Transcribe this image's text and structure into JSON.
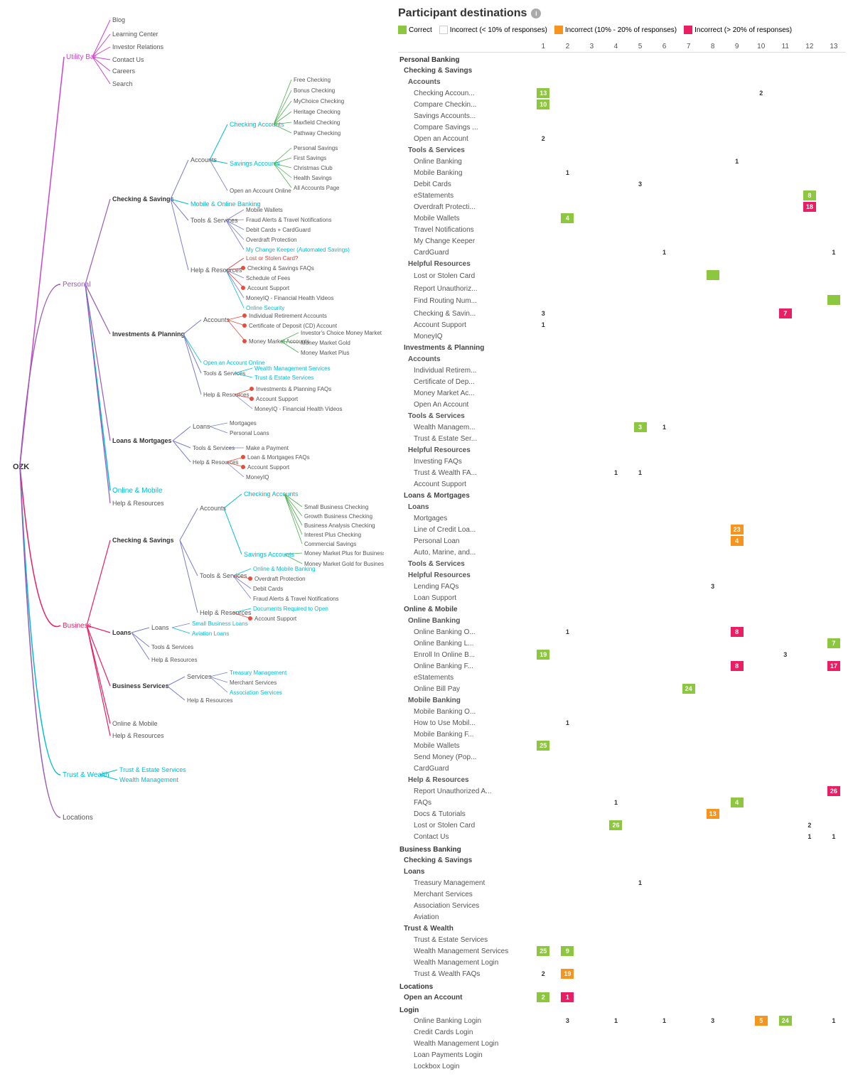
{
  "title": "Participant destinations",
  "legend": [
    {
      "label": "Correct",
      "type": "correct"
    },
    {
      "label": "Incorrect (< 10% of responses)",
      "type": "incorrect-10"
    },
    {
      "label": "Incorrect (10% - 20% of responses)",
      "type": "incorrect-20"
    },
    {
      "label": "Incorrect (> 20% of responses)",
      "type": "incorrect-more"
    }
  ],
  "columns": [
    "1",
    "2",
    "3",
    "4",
    "5",
    "6",
    "7",
    "8",
    "9",
    "10",
    "11",
    "12",
    "13"
  ],
  "rows": [
    {
      "label": "Personal Banking",
      "type": "section-header",
      "cells": []
    },
    {
      "label": "Checking & Savings",
      "type": "sub-header",
      "cells": []
    },
    {
      "label": "Accounts",
      "type": "sub-header2",
      "cells": []
    },
    {
      "label": "Checking Accoun...",
      "type": "item",
      "cells": [
        {
          "col": 1,
          "val": "13",
          "color": "green"
        },
        {
          "col": 10,
          "val": "2",
          "color": "white"
        }
      ]
    },
    {
      "label": "Compare Checkin...",
      "type": "item",
      "cells": [
        {
          "col": 1,
          "val": "10",
          "color": "green"
        }
      ]
    },
    {
      "label": "Savings Accounts...",
      "type": "item",
      "cells": []
    },
    {
      "label": "Compare Savings ...",
      "type": "item",
      "cells": []
    },
    {
      "label": "Open an Account",
      "type": "item",
      "cells": [
        {
          "col": 1,
          "val": "2",
          "color": "white"
        }
      ]
    },
    {
      "label": "Tools & Services",
      "type": "sub-header2",
      "cells": []
    },
    {
      "label": "Online Banking",
      "type": "item",
      "cells": [
        {
          "col": 9,
          "val": "1",
          "color": "white"
        }
      ]
    },
    {
      "label": "Mobile Banking",
      "type": "item",
      "cells": [
        {
          "col": 2,
          "val": "1",
          "color": "white"
        }
      ]
    },
    {
      "label": "Debit Cards",
      "type": "item",
      "cells": [
        {
          "col": 5,
          "val": "3",
          "color": "white"
        }
      ]
    },
    {
      "label": "eStatements",
      "type": "item",
      "cells": [
        {
          "col": 12,
          "val": "8",
          "color": "green"
        }
      ]
    },
    {
      "label": "Overdraft Protecti...",
      "type": "item",
      "cells": [
        {
          "col": 12,
          "val": "18",
          "color": "pink"
        }
      ]
    },
    {
      "label": "Mobile Wallets",
      "type": "item",
      "cells": [
        {
          "col": 2,
          "val": "4",
          "color": "green"
        }
      ]
    },
    {
      "label": "Travel Notifications",
      "type": "item",
      "cells": []
    },
    {
      "label": "My Change Keeper",
      "type": "item",
      "cells": []
    },
    {
      "label": "CardGuard",
      "type": "item",
      "cells": [
        {
          "col": 6,
          "val": "1",
          "color": "white"
        },
        {
          "col": 13,
          "val": "1",
          "color": "white"
        }
      ]
    },
    {
      "label": "Helpful Resources",
      "type": "sub-header2",
      "cells": []
    },
    {
      "label": "Lost or Stolen Card",
      "type": "item",
      "cells": [
        {
          "col": 8,
          "val": "",
          "color": "green"
        }
      ]
    },
    {
      "label": "Report Unauthoriz...",
      "type": "item",
      "cells": []
    },
    {
      "label": "Find Routing Num...",
      "type": "item",
      "cells": [
        {
          "col": 13,
          "val": "",
          "color": "green"
        }
      ]
    },
    {
      "label": "Checking & Savin...",
      "type": "item",
      "cells": [
        {
          "col": 1,
          "val": "3",
          "color": "white"
        },
        {
          "col": 11,
          "val": "7",
          "color": "pink"
        }
      ]
    },
    {
      "label": "Account Support",
      "type": "item",
      "cells": [
        {
          "col": 1,
          "val": "1",
          "color": "white"
        }
      ]
    },
    {
      "label": "MoneyIQ",
      "type": "item",
      "cells": []
    },
    {
      "label": "Investments & Planning",
      "type": "sub-header",
      "cells": []
    },
    {
      "label": "Accounts",
      "type": "sub-header2",
      "cells": []
    },
    {
      "label": "Individual Retirem...",
      "type": "item",
      "cells": []
    },
    {
      "label": "Certificate of Dep...",
      "type": "item",
      "cells": []
    },
    {
      "label": "Money Market Ac...",
      "type": "item",
      "cells": []
    },
    {
      "label": "Open An Account",
      "type": "item",
      "cells": []
    },
    {
      "label": "Tools & Services",
      "type": "sub-header2",
      "cells": []
    },
    {
      "label": "Wealth Managem...",
      "type": "item",
      "cells": [
        {
          "col": 5,
          "val": "3",
          "color": "green"
        },
        {
          "col": 6,
          "val": "1",
          "color": "white"
        }
      ]
    },
    {
      "label": "Trust & Estate Ser...",
      "type": "item",
      "cells": []
    },
    {
      "label": "Helpful Resources",
      "type": "sub-header2",
      "cells": []
    },
    {
      "label": "Investing FAQs",
      "type": "item",
      "cells": []
    },
    {
      "label": "Trust & Wealth FA...",
      "type": "item",
      "cells": [
        {
          "col": 4,
          "val": "1",
          "color": "white"
        },
        {
          "col": 5,
          "val": "1",
          "color": "white"
        }
      ]
    },
    {
      "label": "Account Support",
      "type": "item",
      "cells": []
    },
    {
      "label": "Loans & Mortgages",
      "type": "sub-header",
      "cells": []
    },
    {
      "label": "Loans",
      "type": "sub-header2",
      "cells": []
    },
    {
      "label": "Mortgages",
      "type": "item",
      "cells": []
    },
    {
      "label": "Line of Credit Loa...",
      "type": "item",
      "cells": [
        {
          "col": 9,
          "val": "23",
          "color": "orange"
        }
      ]
    },
    {
      "label": "Personal Loan",
      "type": "item",
      "cells": [
        {
          "col": 9,
          "val": "4",
          "color": "orange"
        }
      ]
    },
    {
      "label": "Auto, Marine, and...",
      "type": "item",
      "cells": []
    },
    {
      "label": "Tools & Services",
      "type": "sub-header2",
      "cells": []
    },
    {
      "label": "Helpful Resources",
      "type": "sub-header2",
      "cells": []
    },
    {
      "label": "Lending FAQs",
      "type": "item",
      "cells": [
        {
          "col": 8,
          "val": "3",
          "color": "white"
        }
      ]
    },
    {
      "label": "Loan Support",
      "type": "item",
      "cells": []
    },
    {
      "label": "Online & Mobile",
      "type": "sub-header",
      "cells": []
    },
    {
      "label": "Online Banking",
      "type": "sub-header2",
      "cells": []
    },
    {
      "label": "Online Banking O...",
      "type": "item",
      "cells": [
        {
          "col": 2,
          "val": "1",
          "color": "white"
        },
        {
          "col": 9,
          "val": "8",
          "color": "pink"
        }
      ]
    },
    {
      "label": "Online Banking L...",
      "type": "item",
      "cells": [
        {
          "col": 13,
          "val": "7",
          "color": "green"
        }
      ]
    },
    {
      "label": "Enroll In Online B...",
      "type": "item",
      "cells": [
        {
          "col": 1,
          "val": "19",
          "color": "green"
        },
        {
          "col": 11,
          "val": "3",
          "color": "white"
        }
      ]
    },
    {
      "label": "Online Banking F...",
      "type": "item",
      "cells": [
        {
          "col": 9,
          "val": "8",
          "color": "pink"
        },
        {
          "col": 13,
          "val": "17",
          "color": "pink"
        }
      ]
    },
    {
      "label": "eStatements",
      "type": "item",
      "cells": []
    },
    {
      "label": "Online Bill Pay",
      "type": "item",
      "cells": [
        {
          "col": 7,
          "val": "24",
          "color": "green"
        }
      ]
    },
    {
      "label": "Mobile Banking",
      "type": "sub-header2",
      "cells": []
    },
    {
      "label": "Mobile Banking O...",
      "type": "item",
      "cells": []
    },
    {
      "label": "How to Use Mobil...",
      "type": "item",
      "cells": [
        {
          "col": 2,
          "val": "1",
          "color": "white"
        }
      ]
    },
    {
      "label": "Mobile Banking F...",
      "type": "item",
      "cells": []
    },
    {
      "label": "Mobile Wallets",
      "type": "item",
      "cells": [
        {
          "col": 1,
          "val": "25",
          "color": "green"
        }
      ]
    },
    {
      "label": "Send Money (Pop...",
      "type": "item",
      "cells": []
    },
    {
      "label": "CardGuard",
      "type": "item",
      "cells": []
    },
    {
      "label": "Help & Resources",
      "type": "sub-header2",
      "cells": []
    },
    {
      "label": "Report Unauthorized A...",
      "type": "item",
      "cells": [
        {
          "col": 13,
          "val": "26",
          "color": "pink"
        }
      ]
    },
    {
      "label": "FAQs",
      "type": "item",
      "cells": [
        {
          "col": 4,
          "val": "1",
          "color": "white"
        },
        {
          "col": 9,
          "val": "4",
          "color": "green"
        }
      ]
    },
    {
      "label": "Docs & Tutorials",
      "type": "item",
      "cells": [
        {
          "col": 8,
          "val": "13",
          "color": "orange"
        }
      ]
    },
    {
      "label": "Lost or Stolen Card",
      "type": "item",
      "cells": [
        {
          "col": 4,
          "val": "26",
          "color": "green"
        },
        {
          "col": 12,
          "val": "2",
          "color": "white"
        }
      ]
    },
    {
      "label": "Contact Us",
      "type": "item",
      "cells": [
        {
          "col": 12,
          "val": "1",
          "color": "white"
        },
        {
          "col": 13,
          "val": "1",
          "color": "white"
        }
      ]
    },
    {
      "label": "Business Banking",
      "type": "section-header",
      "cells": []
    },
    {
      "label": "Checking & Savings",
      "type": "sub-header",
      "cells": []
    },
    {
      "label": "Loans",
      "type": "sub-header",
      "cells": []
    },
    {
      "label": "Treasury Management",
      "type": "item",
      "cells": [
        {
          "col": 5,
          "val": "1",
          "color": "white"
        }
      ]
    },
    {
      "label": "Merchant Services",
      "type": "item",
      "cells": []
    },
    {
      "label": "Association Services",
      "type": "item",
      "cells": []
    },
    {
      "label": "Aviation",
      "type": "item",
      "cells": []
    },
    {
      "label": "Trust & Wealth",
      "type": "sub-header",
      "cells": []
    },
    {
      "label": "Trust & Estate Services",
      "type": "item",
      "cells": []
    },
    {
      "label": "Wealth Management Services",
      "type": "item",
      "cells": [
        {
          "col": 1,
          "val": "25",
          "color": "green"
        },
        {
          "col": 2,
          "val": "9",
          "color": "green"
        }
      ]
    },
    {
      "label": "Wealth Management Login",
      "type": "item",
      "cells": []
    },
    {
      "label": "Trust & Wealth FAQs",
      "type": "item",
      "cells": [
        {
          "col": 1,
          "val": "2",
          "color": "white"
        },
        {
          "col": 2,
          "val": "19",
          "color": "orange"
        }
      ]
    },
    {
      "label": "Locations",
      "type": "section-header",
      "cells": []
    },
    {
      "label": "Open an Account",
      "type": "sub-header",
      "cells": [
        {
          "col": 1,
          "val": "2",
          "color": "green"
        },
        {
          "col": 2,
          "val": "1",
          "color": "pink"
        }
      ]
    },
    {
      "label": "Login",
      "type": "section-header",
      "cells": []
    },
    {
      "label": "Online Banking Login",
      "type": "item",
      "cells": [
        {
          "col": 2,
          "val": "3",
          "color": "white"
        },
        {
          "col": 4,
          "val": "1",
          "color": "white"
        },
        {
          "col": 6,
          "val": "1",
          "color": "white"
        },
        {
          "col": 8,
          "val": "3",
          "color": "white"
        },
        {
          "col": 10,
          "val": "5",
          "color": "orange"
        },
        {
          "col": 11,
          "val": "24",
          "color": "green"
        },
        {
          "col": 13,
          "val": "1",
          "color": "white"
        }
      ]
    },
    {
      "label": "Credit Cards Login",
      "type": "item",
      "cells": []
    },
    {
      "label": "Wealth Management Login",
      "type": "item",
      "cells": []
    },
    {
      "label": "Loan Payments Login",
      "type": "item",
      "cells": []
    },
    {
      "label": "Lockbox Login",
      "type": "item",
      "cells": []
    }
  ]
}
